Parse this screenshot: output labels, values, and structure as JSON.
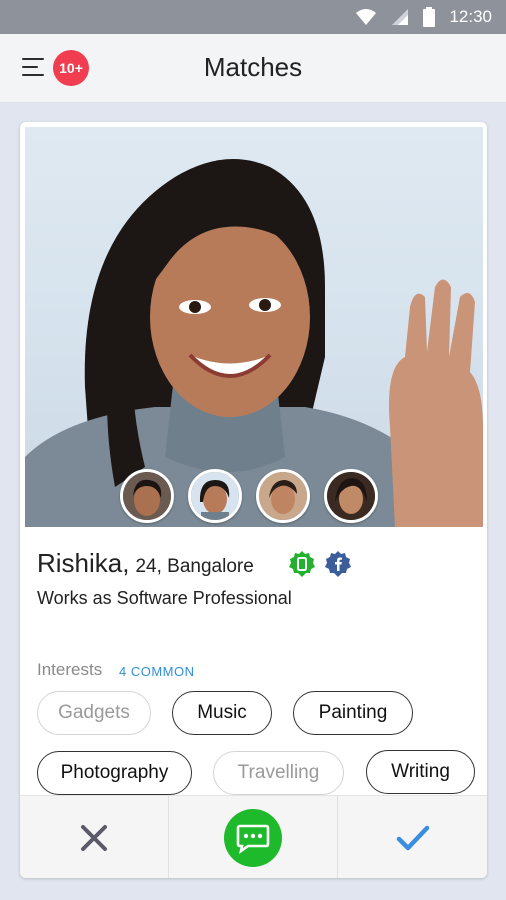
{
  "status_bar": {
    "time": "12:30",
    "icons": [
      "wifi-icon",
      "signal-icon",
      "battery-icon"
    ]
  },
  "header": {
    "title": "Matches",
    "badge": "10+",
    "menu_icon": "hamburger-menu-icon"
  },
  "profile": {
    "name": "Rishika,",
    "age_city": "24, Bangalore",
    "occupation": "Works as Software Professional",
    "verifications": [
      "phone-verified-icon",
      "facebook-verified-icon"
    ],
    "photo_thumbnails": 4,
    "selected_photo_index": 2
  },
  "interests": {
    "label": "Interests",
    "common": "4 COMMON",
    "items": [
      {
        "label": "Gadgets",
        "common": false
      },
      {
        "label": "Music",
        "common": true
      },
      {
        "label": "Painting",
        "common": true
      },
      {
        "label": "Photography",
        "common": true
      },
      {
        "label": "Travelling",
        "common": false
      },
      {
        "label": "Writing",
        "common": true
      }
    ]
  },
  "actions": {
    "reject": "close-icon",
    "chat": "chat-icon",
    "accept": "check-icon"
  },
  "colors": {
    "accent": "#2f8fd8",
    "badge": "#f03d4f",
    "chat": "#1fba2b",
    "reject": "#5a5a6a"
  }
}
